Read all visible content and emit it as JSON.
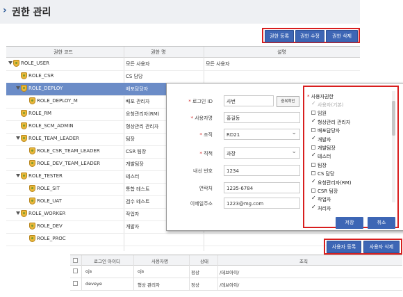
{
  "page": {
    "title": "권한 관리"
  },
  "toolbar": {
    "register": "권한 등록",
    "edit": "권한 수정",
    "delete": "권한 삭제"
  },
  "tree": {
    "headers": {
      "code": "권한 코드",
      "name": "권한 명",
      "desc": "설명"
    },
    "rows": [
      {
        "code": "ROLE_USER",
        "name": "모든 사용자",
        "desc": "모든 사용자",
        "depth": 0,
        "expanded": true
      },
      {
        "code": "ROLE_CSR",
        "name": "CS 담당",
        "desc": "",
        "depth": 1,
        "expanded": false
      },
      {
        "code": "ROLE_DEPLOY",
        "name": "배포담당자",
        "desc": "",
        "depth": 1,
        "expanded": true,
        "selected": true
      },
      {
        "code": "ROLE_DEPLOY_M",
        "name": "배포 관리자",
        "desc": "",
        "depth": 2,
        "expanded": false
      },
      {
        "code": "ROLE_RM",
        "name": "요청관리자(RM)",
        "desc": "",
        "depth": 1,
        "expanded": false
      },
      {
        "code": "ROLE_SCM_ADMIN",
        "name": "형상관리 관리자",
        "desc": "",
        "depth": 1,
        "expanded": false
      },
      {
        "code": "ROLE_TEAM_LEADER",
        "name": "팀장",
        "desc": "",
        "depth": 1,
        "expanded": true
      },
      {
        "code": "ROLE_CSR_TEAM_LEADER",
        "name": "CSR 팀장",
        "desc": "",
        "depth": 2,
        "expanded": false
      },
      {
        "code": "ROLE_DEV_TEAM_LEADER",
        "name": "개발팀장",
        "desc": "",
        "depth": 2,
        "expanded": false
      },
      {
        "code": "ROLE_TESTER",
        "name": "테스터",
        "desc": "",
        "depth": 1,
        "expanded": true
      },
      {
        "code": "ROLE_SIT",
        "name": "통합 테스트",
        "desc": "",
        "depth": 2,
        "expanded": false
      },
      {
        "code": "ROLE_UAT",
        "name": "검수 테스트",
        "desc": "",
        "depth": 2,
        "expanded": false
      },
      {
        "code": "ROLE_WORKER",
        "name": "작업자",
        "desc": "",
        "depth": 1,
        "expanded": true
      },
      {
        "code": "ROLE_DEV",
        "name": "개발자",
        "desc": "",
        "depth": 2,
        "expanded": false
      },
      {
        "code": "ROLE_PROC",
        "name": "",
        "desc": "",
        "depth": 2,
        "expanded": false
      }
    ]
  },
  "popup": {
    "fields": {
      "login_id": {
        "label": "로그인 ID",
        "value": "사번",
        "required": true
      },
      "dup_check": "중복확인",
      "user_name": {
        "label": "사용자명",
        "value": "홍길동",
        "required": true
      },
      "org": {
        "label": "조직",
        "value": "RD21",
        "required": true
      },
      "position": {
        "label": "직책",
        "value": "과장",
        "required": true
      },
      "ext": {
        "label": "내선 번호",
        "value": "1234"
      },
      "phone": {
        "label": "연락처",
        "value": "1235-6784"
      },
      "email": {
        "label": "이메일주소",
        "value": "1223@mg.com"
      }
    },
    "roles_title": "사용자권한",
    "roles": [
      {
        "label": "사용자(기본)",
        "checked": true,
        "disabled": true
      },
      {
        "label": "임원",
        "checked": false
      },
      {
        "label": "형상관리 관리자",
        "checked": true
      },
      {
        "label": "배포담당자",
        "checked": false
      },
      {
        "label": "개발자",
        "checked": true
      },
      {
        "label": "개발팀장",
        "checked": false
      },
      {
        "label": "테스터",
        "checked": true
      },
      {
        "label": "팀장",
        "checked": false
      },
      {
        "label": "CS 담당",
        "checked": false
      },
      {
        "label": "요청관리자(RM)",
        "checked": true
      },
      {
        "label": "CSR 팀장",
        "checked": false
      },
      {
        "label": "작업자",
        "checked": true
      },
      {
        "label": "처리자",
        "checked": true
      }
    ],
    "save": "저장",
    "cancel": "취소"
  },
  "user_toolbar": {
    "register": "사용자 등록",
    "delete": "사용자 삭제"
  },
  "users": {
    "headers": {
      "id": "로그인 아이디",
      "name": "사용자명",
      "status": "상태",
      "org": "조직"
    },
    "rows": [
      {
        "id": "ojs",
        "name": "ojs",
        "status": "정상",
        "org": "/데브아이/"
      },
      {
        "id": "deveye",
        "name": "형상 관리자",
        "status": "정상",
        "org": "/데브아이/"
      }
    ]
  },
  "colors": {
    "accent": "#3d66b5",
    "highlight": "#d81e1e",
    "selected_row": "#6b8cc7"
  }
}
